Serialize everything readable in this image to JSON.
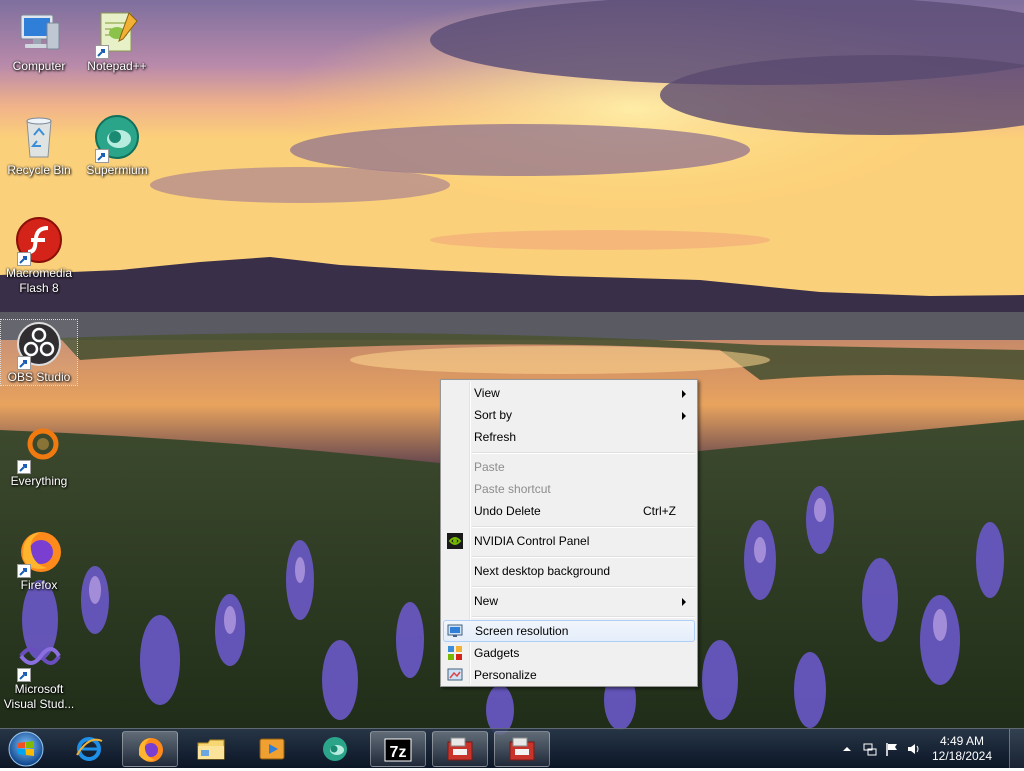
{
  "desktop": {
    "icons": [
      {
        "label": "Computer",
        "icon": "computer-icon"
      },
      {
        "label": "Notepad++",
        "icon": "notepad-plus-plus-icon"
      },
      {
        "label": "Recycle Bin",
        "icon": "recycle-bin-icon"
      },
      {
        "label": "Supermium",
        "icon": "supermium-icon"
      },
      {
        "label": "Macromedia Flash 8",
        "icon": "flash-icon"
      },
      {
        "label": "OBS Studio",
        "icon": "obs-icon"
      },
      {
        "label": "Everything",
        "icon": "everything-icon"
      },
      {
        "label": "Firefox",
        "icon": "firefox-icon"
      },
      {
        "label": "Microsoft Visual Stud...",
        "icon": "visual-studio-icon"
      }
    ]
  },
  "context_menu": {
    "view": "View",
    "sort_by": "Sort by",
    "refresh": "Refresh",
    "paste": "Paste",
    "paste_shortcut": "Paste shortcut",
    "undo_delete": "Undo Delete",
    "undo_shortcut": "Ctrl+Z",
    "nvidia": "NVIDIA Control Panel",
    "next_bg": "Next desktop background",
    "new": "New",
    "screen_resolution": "Screen resolution",
    "gadgets": "Gadgets",
    "personalize": "Personalize"
  },
  "taskbar": {
    "pinned": [
      "internet-explorer-icon",
      "firefox-icon",
      "file-explorer-icon",
      "media-player-icon",
      "supermium-icon",
      "7zip-icon",
      "app-icon",
      "app-icon"
    ],
    "seven_zip_label": "7z",
    "time": "4:49 AM",
    "date": "12/18/2024"
  },
  "colors": {
    "menu_bg": "#f0f0f0",
    "highlight_border": "#aecff7",
    "taskbar": "#1a2940"
  }
}
